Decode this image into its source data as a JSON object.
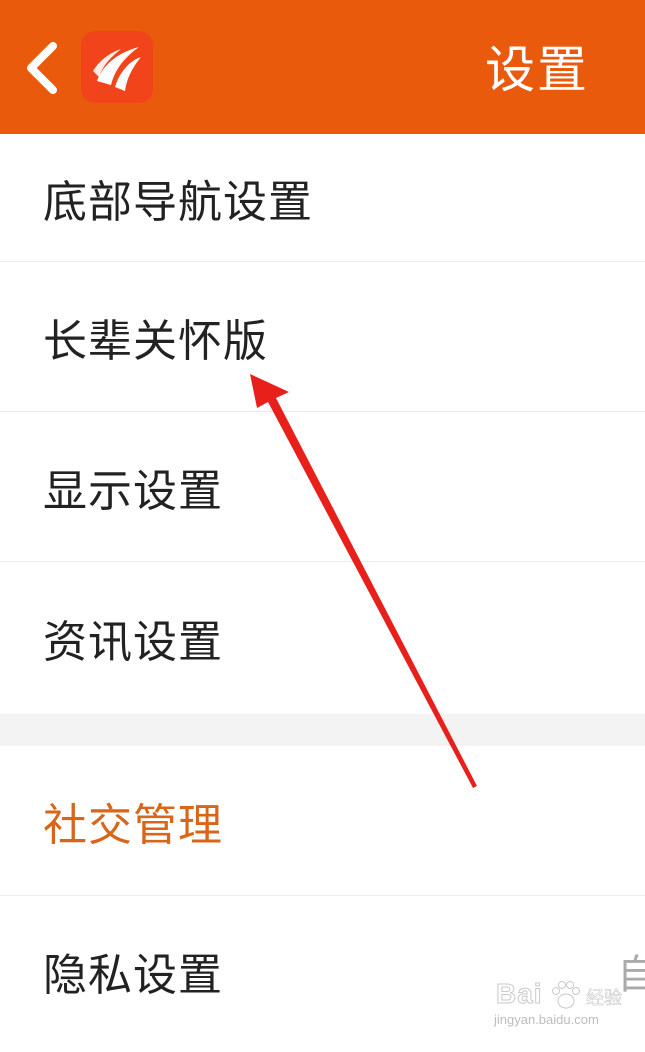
{
  "header": {
    "title": "设置",
    "back_icon": "chevron-left-icon",
    "logo_icon": "app-logo-icon"
  },
  "menu": {
    "bottom_nav": "底部导航设置",
    "elder_mode": "长辈关怀版",
    "display": "显示设置",
    "news": "资讯设置"
  },
  "social": {
    "section_title": "社交管理",
    "privacy": "隐私设置",
    "privacy_value": "自"
  },
  "watermark": {
    "brand": "Bai",
    "brand_cn": "经验",
    "url": "jingyan.baidu.com"
  },
  "colors": {
    "accent": "#e95a0c",
    "section_header": "#d8651a",
    "annotation": "#e8201c"
  }
}
